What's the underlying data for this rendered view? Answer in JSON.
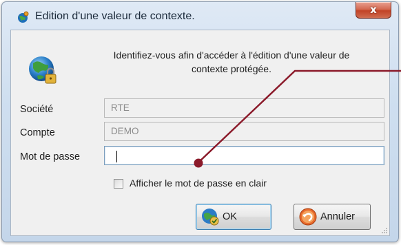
{
  "window": {
    "title": "Edition d'une valeur de contexte.",
    "close_label": "x"
  },
  "message": {
    "line1": "Identifiez-vous afin d'accéder à l'édition d'une valeur de",
    "line2": "contexte protégée."
  },
  "form": {
    "societe": {
      "label": "Société",
      "value": "RTE"
    },
    "compte": {
      "label": "Compte",
      "value": "DEMO"
    },
    "password": {
      "label": "Mot de passe",
      "value": ""
    },
    "show_password": {
      "label": "Afficher le mot de passe en clair",
      "checked": false
    }
  },
  "buttons": {
    "ok_label": "OK",
    "cancel_label": "Annuler"
  },
  "icons": {
    "title": "settings-globe-icon",
    "header": "globe-lock-icon",
    "ok": "globe-check-icon",
    "cancel": "undo-arrow-icon"
  },
  "colors": {
    "annotation": "#8b1a2a",
    "close_button": "#c9452a",
    "default_button_border": "#3c7fb1"
  }
}
